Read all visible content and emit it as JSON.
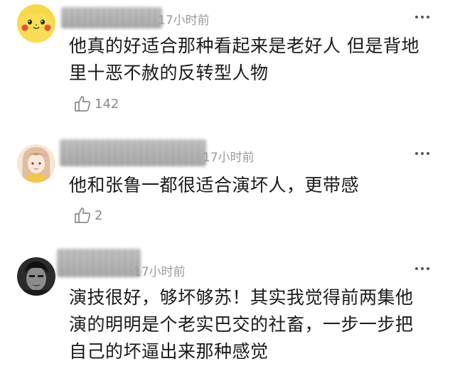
{
  "comments": [
    {
      "time": "17小时前",
      "text_line1": "他真的好适合那种看起来是老好人 但是背地",
      "text_line2": "里十恶不赦的反转型人物",
      "likes": "142",
      "avatar_icon": "pikachu-avatar-icon"
    },
    {
      "time": "17小时前",
      "text_line1": "他和张鲁一都很适合演坏人，更带感",
      "likes": "2",
      "avatar_icon": "girl-drawing-avatar-icon"
    },
    {
      "time": "17小时前",
      "text_line1": "演技很好，够坏够苏！其实我觉得前两集他",
      "text_line2": "演的明明是个老实巴交的社畜，一步一步把",
      "text_line3": "自己的坏逼出来那种感觉",
      "avatar_icon": "dark-portrait-avatar-icon"
    }
  ],
  "colors": {
    "text": "#1a1a1a",
    "meta": "#9a9a9a",
    "like": "#8a8a8a"
  }
}
